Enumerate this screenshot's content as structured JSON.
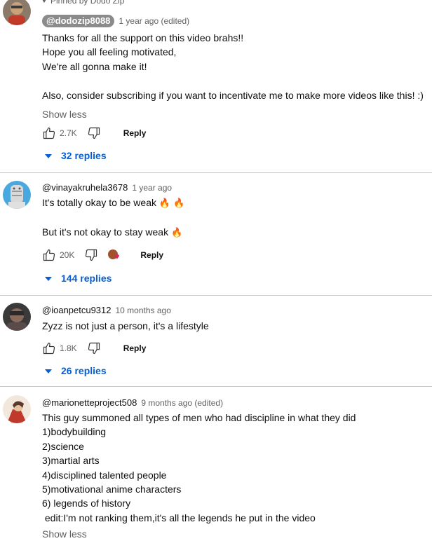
{
  "comments": [
    {
      "pinned_label": "Pinned by Dodo Zip",
      "author": "@dodozip8088",
      "timestamp": "1 year ago (edited)",
      "lines": [
        "Thanks for all the support on this video brahs!!",
        "Hope you all feeling motivated,",
        "We're all gonna make it!",
        "",
        "Also, consider subscribing if you want to incentivate me to make more videos like this! :)"
      ],
      "show_less": "Show less",
      "likes": "2.7K",
      "reply_label": "Reply",
      "replies": "32 replies"
    },
    {
      "author": "@vinayakruhela3678",
      "timestamp": "1 year ago",
      "line1": "It's totally okay to be weak",
      "line2": "But it's not okay to stay weak",
      "fire": "🔥",
      "likes": "20K",
      "reply_label": "Reply",
      "replies": "144 replies"
    },
    {
      "author": "@ioanpetcu9312",
      "timestamp": "10 months ago",
      "lines": [
        "Zyzz is not just a person, it's a lifestyle"
      ],
      "likes": "1.8K",
      "reply_label": "Reply",
      "replies": "26 replies"
    },
    {
      "author": "@marionetteproject508",
      "timestamp": "9 months ago (edited)",
      "lines": [
        "This guy summoned all types of men  who had discipline in what they did",
        "1)bodybuilding",
        "2)science",
        "3)martial arts",
        "4)disciplined talented people",
        "5)motivational anime characters",
        "6) legends of history",
        " edit:I'm not ranking them,it's all the legends he put in the video"
      ],
      "show_less": "Show less"
    }
  ],
  "icons": {
    "like": "thumbs-up-icon",
    "dislike": "thumbs-down-icon",
    "creator_heart": "creator-heart-icon",
    "expand": "caret-down-icon"
  },
  "colors": {
    "link_blue": "#065fd4",
    "meta_gray": "#606060",
    "pill_gray": "#8b8b8b",
    "heart_red": "#e0245e"
  }
}
